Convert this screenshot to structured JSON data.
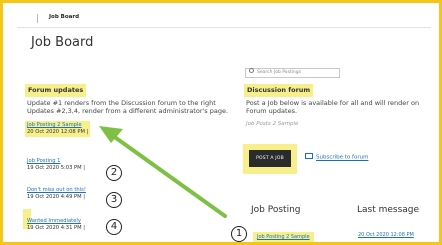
{
  "header": {
    "site_title": "Job Board"
  },
  "page": {
    "title": "Job Board"
  },
  "search": {
    "placeholder": "Search Job Postings",
    "icon": "search-icon"
  },
  "forum_updates": {
    "heading": "Forum updates",
    "description": "Update #1 renders from the Discussion forum to the right Updates #2,3,4, render from a different administrator's page.",
    "items": [
      {
        "title": "Job Posting 2 Sample",
        "date": "20 Oct 2020 12:08 PM |",
        "number": ""
      },
      {
        "title": "Job Posting 1",
        "date": "19 Oct 2020 5:03 PM |",
        "number": "2"
      },
      {
        "title": "Don't miss out on this!",
        "date": "19 Oct 2020 4:49 PM |",
        "number": "3"
      },
      {
        "title": "Wanted Immediately",
        "date": "19 Oct 2020 4:31 PM |",
        "number": "4"
      }
    ]
  },
  "discussion_forum": {
    "heading": "Discussion forum",
    "description": "Post a Job below is available for all and will render on Forum updates.",
    "sub_note": "Job Posts 2 Sample",
    "post_button": "POST A JOB",
    "subscribe_label": "Subscribe to forum",
    "subscribe_icon": "mail-icon"
  },
  "job_table": {
    "columns": [
      "Job Posting",
      "Last message"
    ],
    "rows": [
      {
        "number": "1",
        "title": "Job Posting 2 Sample",
        "last_message": "20 Oct 2020 12:08 PM"
      }
    ]
  },
  "colors": {
    "highlight": "#f6ef8c",
    "frame": "#f5c518",
    "link": "#1a6fbf",
    "arrow": "#7dc043"
  }
}
